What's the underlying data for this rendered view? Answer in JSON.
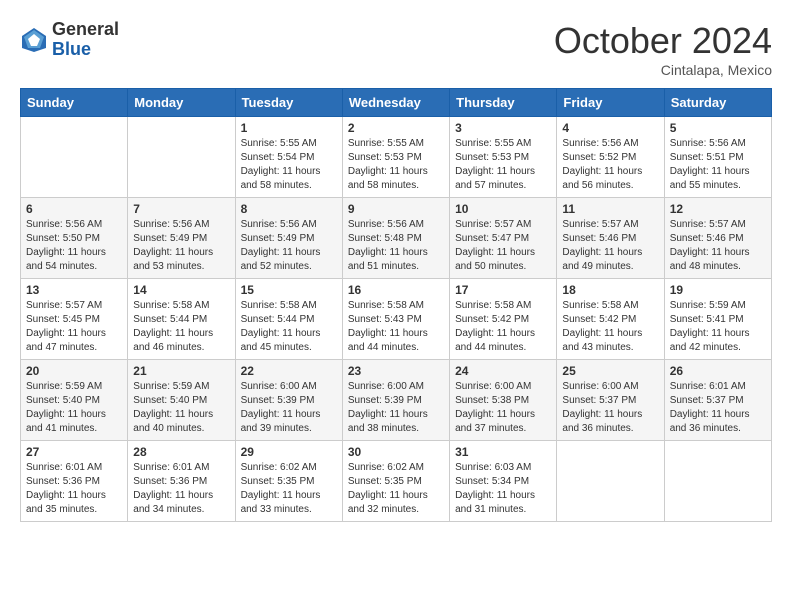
{
  "header": {
    "logo_general": "General",
    "logo_blue": "Blue",
    "month_title": "October 2024",
    "location": "Cintalapa, Mexico"
  },
  "days_of_week": [
    "Sunday",
    "Monday",
    "Tuesday",
    "Wednesday",
    "Thursday",
    "Friday",
    "Saturday"
  ],
  "weeks": [
    [
      {
        "day": "",
        "sunrise": "",
        "sunset": "",
        "daylight": ""
      },
      {
        "day": "",
        "sunrise": "",
        "sunset": "",
        "daylight": ""
      },
      {
        "day": "1",
        "sunrise": "Sunrise: 5:55 AM",
        "sunset": "Sunset: 5:54 PM",
        "daylight": "Daylight: 11 hours and 58 minutes."
      },
      {
        "day": "2",
        "sunrise": "Sunrise: 5:55 AM",
        "sunset": "Sunset: 5:53 PM",
        "daylight": "Daylight: 11 hours and 58 minutes."
      },
      {
        "day": "3",
        "sunrise": "Sunrise: 5:55 AM",
        "sunset": "Sunset: 5:53 PM",
        "daylight": "Daylight: 11 hours and 57 minutes."
      },
      {
        "day": "4",
        "sunrise": "Sunrise: 5:56 AM",
        "sunset": "Sunset: 5:52 PM",
        "daylight": "Daylight: 11 hours and 56 minutes."
      },
      {
        "day": "5",
        "sunrise": "Sunrise: 5:56 AM",
        "sunset": "Sunset: 5:51 PM",
        "daylight": "Daylight: 11 hours and 55 minutes."
      }
    ],
    [
      {
        "day": "6",
        "sunrise": "Sunrise: 5:56 AM",
        "sunset": "Sunset: 5:50 PM",
        "daylight": "Daylight: 11 hours and 54 minutes."
      },
      {
        "day": "7",
        "sunrise": "Sunrise: 5:56 AM",
        "sunset": "Sunset: 5:49 PM",
        "daylight": "Daylight: 11 hours and 53 minutes."
      },
      {
        "day": "8",
        "sunrise": "Sunrise: 5:56 AM",
        "sunset": "Sunset: 5:49 PM",
        "daylight": "Daylight: 11 hours and 52 minutes."
      },
      {
        "day": "9",
        "sunrise": "Sunrise: 5:56 AM",
        "sunset": "Sunset: 5:48 PM",
        "daylight": "Daylight: 11 hours and 51 minutes."
      },
      {
        "day": "10",
        "sunrise": "Sunrise: 5:57 AM",
        "sunset": "Sunset: 5:47 PM",
        "daylight": "Daylight: 11 hours and 50 minutes."
      },
      {
        "day": "11",
        "sunrise": "Sunrise: 5:57 AM",
        "sunset": "Sunset: 5:46 PM",
        "daylight": "Daylight: 11 hours and 49 minutes."
      },
      {
        "day": "12",
        "sunrise": "Sunrise: 5:57 AM",
        "sunset": "Sunset: 5:46 PM",
        "daylight": "Daylight: 11 hours and 48 minutes."
      }
    ],
    [
      {
        "day": "13",
        "sunrise": "Sunrise: 5:57 AM",
        "sunset": "Sunset: 5:45 PM",
        "daylight": "Daylight: 11 hours and 47 minutes."
      },
      {
        "day": "14",
        "sunrise": "Sunrise: 5:58 AM",
        "sunset": "Sunset: 5:44 PM",
        "daylight": "Daylight: 11 hours and 46 minutes."
      },
      {
        "day": "15",
        "sunrise": "Sunrise: 5:58 AM",
        "sunset": "Sunset: 5:44 PM",
        "daylight": "Daylight: 11 hours and 45 minutes."
      },
      {
        "day": "16",
        "sunrise": "Sunrise: 5:58 AM",
        "sunset": "Sunset: 5:43 PM",
        "daylight": "Daylight: 11 hours and 44 minutes."
      },
      {
        "day": "17",
        "sunrise": "Sunrise: 5:58 AM",
        "sunset": "Sunset: 5:42 PM",
        "daylight": "Daylight: 11 hours and 44 minutes."
      },
      {
        "day": "18",
        "sunrise": "Sunrise: 5:58 AM",
        "sunset": "Sunset: 5:42 PM",
        "daylight": "Daylight: 11 hours and 43 minutes."
      },
      {
        "day": "19",
        "sunrise": "Sunrise: 5:59 AM",
        "sunset": "Sunset: 5:41 PM",
        "daylight": "Daylight: 11 hours and 42 minutes."
      }
    ],
    [
      {
        "day": "20",
        "sunrise": "Sunrise: 5:59 AM",
        "sunset": "Sunset: 5:40 PM",
        "daylight": "Daylight: 11 hours and 41 minutes."
      },
      {
        "day": "21",
        "sunrise": "Sunrise: 5:59 AM",
        "sunset": "Sunset: 5:40 PM",
        "daylight": "Daylight: 11 hours and 40 minutes."
      },
      {
        "day": "22",
        "sunrise": "Sunrise: 6:00 AM",
        "sunset": "Sunset: 5:39 PM",
        "daylight": "Daylight: 11 hours and 39 minutes."
      },
      {
        "day": "23",
        "sunrise": "Sunrise: 6:00 AM",
        "sunset": "Sunset: 5:39 PM",
        "daylight": "Daylight: 11 hours and 38 minutes."
      },
      {
        "day": "24",
        "sunrise": "Sunrise: 6:00 AM",
        "sunset": "Sunset: 5:38 PM",
        "daylight": "Daylight: 11 hours and 37 minutes."
      },
      {
        "day": "25",
        "sunrise": "Sunrise: 6:00 AM",
        "sunset": "Sunset: 5:37 PM",
        "daylight": "Daylight: 11 hours and 36 minutes."
      },
      {
        "day": "26",
        "sunrise": "Sunrise: 6:01 AM",
        "sunset": "Sunset: 5:37 PM",
        "daylight": "Daylight: 11 hours and 36 minutes."
      }
    ],
    [
      {
        "day": "27",
        "sunrise": "Sunrise: 6:01 AM",
        "sunset": "Sunset: 5:36 PM",
        "daylight": "Daylight: 11 hours and 35 minutes."
      },
      {
        "day": "28",
        "sunrise": "Sunrise: 6:01 AM",
        "sunset": "Sunset: 5:36 PM",
        "daylight": "Daylight: 11 hours and 34 minutes."
      },
      {
        "day": "29",
        "sunrise": "Sunrise: 6:02 AM",
        "sunset": "Sunset: 5:35 PM",
        "daylight": "Daylight: 11 hours and 33 minutes."
      },
      {
        "day": "30",
        "sunrise": "Sunrise: 6:02 AM",
        "sunset": "Sunset: 5:35 PM",
        "daylight": "Daylight: 11 hours and 32 minutes."
      },
      {
        "day": "31",
        "sunrise": "Sunrise: 6:03 AM",
        "sunset": "Sunset: 5:34 PM",
        "daylight": "Daylight: 11 hours and 31 minutes."
      },
      {
        "day": "",
        "sunrise": "",
        "sunset": "",
        "daylight": ""
      },
      {
        "day": "",
        "sunrise": "",
        "sunset": "",
        "daylight": ""
      }
    ]
  ]
}
